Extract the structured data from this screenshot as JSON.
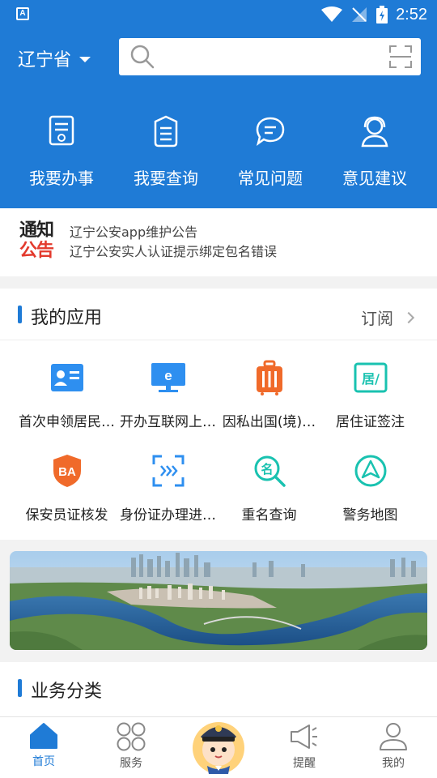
{
  "status_bar": {
    "time": "2:52"
  },
  "header": {
    "province": "辽宁省",
    "search": {
      "placeholder": "",
      "value": ""
    }
  },
  "quick_actions": [
    {
      "label": "我要办事",
      "icon": "document-icon"
    },
    {
      "label": "我要查询",
      "icon": "list-icon"
    },
    {
      "label": "常见问题",
      "icon": "chat-icon"
    },
    {
      "label": "意见建议",
      "icon": "headset-icon"
    }
  ],
  "notice": {
    "logo_top": "通知",
    "logo_bottom": "公告",
    "items": [
      "辽宁公安app维护公告",
      "辽宁公安实人认证提示绑定包名错误"
    ]
  },
  "my_apps": {
    "title": "我的应用",
    "subscribe": "订阅",
    "items": [
      {
        "label": "首次申领居民…",
        "icon": "id-card-icon"
      },
      {
        "label": "开办互联网上…",
        "icon": "computer-icon"
      },
      {
        "label": "因私出国(境)…",
        "icon": "luggage-icon"
      },
      {
        "label": "居住证签注",
        "icon": "residence-permit-icon"
      },
      {
        "label": "保安员证核发",
        "icon": "security-badge-icon"
      },
      {
        "label": "身份证办理进…",
        "icon": "progress-scan-icon"
      },
      {
        "label": "重名查询",
        "icon": "name-search-icon"
      },
      {
        "label": "警务地图",
        "icon": "navigation-icon"
      }
    ],
    "badge_text": "BA",
    "residence_text": "居/",
    "name_text": "名",
    "computer_text": "e"
  },
  "category": {
    "title": "业务分类"
  },
  "tabbar": {
    "items": [
      {
        "label": "首页",
        "active": true
      },
      {
        "label": "服务",
        "active": false
      },
      {
        "label": "提醒",
        "active": false
      },
      {
        "label": "我的",
        "active": false
      }
    ]
  },
  "colors": {
    "primary": "#1f7bd6",
    "notice_red": "#e33a2d",
    "app_blue": "#2e8ff0",
    "app_orange": "#f06a2a",
    "app_teal": "#19c2b0"
  }
}
